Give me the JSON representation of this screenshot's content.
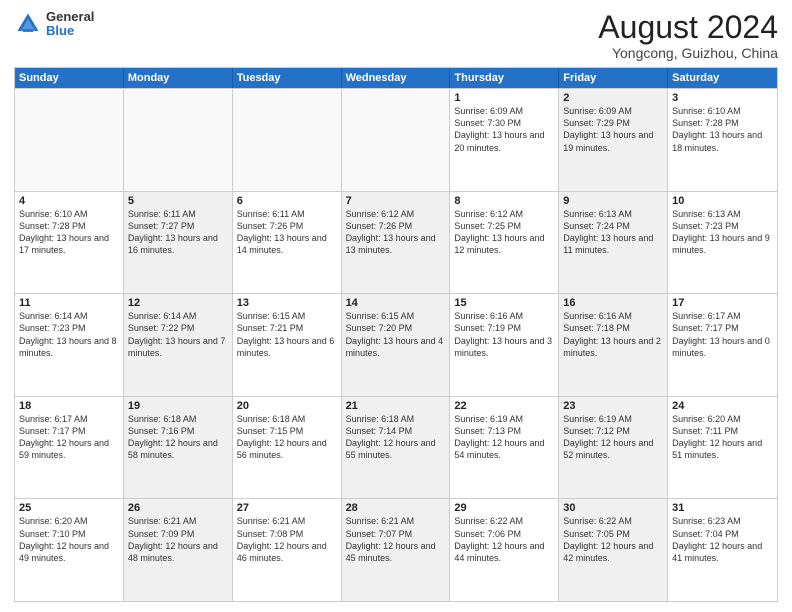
{
  "logo": {
    "general": "General",
    "blue": "Blue"
  },
  "title": "August 2024",
  "location": "Yongcong, Guizhou, China",
  "weekdays": [
    "Sunday",
    "Monday",
    "Tuesday",
    "Wednesday",
    "Thursday",
    "Friday",
    "Saturday"
  ],
  "rows": [
    [
      {
        "day": "",
        "text": "",
        "empty": true
      },
      {
        "day": "",
        "text": "",
        "empty": true
      },
      {
        "day": "",
        "text": "",
        "empty": true
      },
      {
        "day": "",
        "text": "",
        "empty": true
      },
      {
        "day": "1",
        "text": "Sunrise: 6:09 AM\nSunset: 7:30 PM\nDaylight: 13 hours and 20 minutes.",
        "empty": false,
        "shaded": false
      },
      {
        "day": "2",
        "text": "Sunrise: 6:09 AM\nSunset: 7:29 PM\nDaylight: 13 hours and 19 minutes.",
        "empty": false,
        "shaded": true
      },
      {
        "day": "3",
        "text": "Sunrise: 6:10 AM\nSunset: 7:28 PM\nDaylight: 13 hours and 18 minutes.",
        "empty": false,
        "shaded": false
      }
    ],
    [
      {
        "day": "4",
        "text": "Sunrise: 6:10 AM\nSunset: 7:28 PM\nDaylight: 13 hours and 17 minutes.",
        "empty": false,
        "shaded": false
      },
      {
        "day": "5",
        "text": "Sunrise: 6:11 AM\nSunset: 7:27 PM\nDaylight: 13 hours and 16 minutes.",
        "empty": false,
        "shaded": true
      },
      {
        "day": "6",
        "text": "Sunrise: 6:11 AM\nSunset: 7:26 PM\nDaylight: 13 hours and 14 minutes.",
        "empty": false,
        "shaded": false
      },
      {
        "day": "7",
        "text": "Sunrise: 6:12 AM\nSunset: 7:26 PM\nDaylight: 13 hours and 13 minutes.",
        "empty": false,
        "shaded": true
      },
      {
        "day": "8",
        "text": "Sunrise: 6:12 AM\nSunset: 7:25 PM\nDaylight: 13 hours and 12 minutes.",
        "empty": false,
        "shaded": false
      },
      {
        "day": "9",
        "text": "Sunrise: 6:13 AM\nSunset: 7:24 PM\nDaylight: 13 hours and 11 minutes.",
        "empty": false,
        "shaded": true
      },
      {
        "day": "10",
        "text": "Sunrise: 6:13 AM\nSunset: 7:23 PM\nDaylight: 13 hours and 9 minutes.",
        "empty": false,
        "shaded": false
      }
    ],
    [
      {
        "day": "11",
        "text": "Sunrise: 6:14 AM\nSunset: 7:23 PM\nDaylight: 13 hours and 8 minutes.",
        "empty": false,
        "shaded": false
      },
      {
        "day": "12",
        "text": "Sunrise: 6:14 AM\nSunset: 7:22 PM\nDaylight: 13 hours and 7 minutes.",
        "empty": false,
        "shaded": true
      },
      {
        "day": "13",
        "text": "Sunrise: 6:15 AM\nSunset: 7:21 PM\nDaylight: 13 hours and 6 minutes.",
        "empty": false,
        "shaded": false
      },
      {
        "day": "14",
        "text": "Sunrise: 6:15 AM\nSunset: 7:20 PM\nDaylight: 13 hours and 4 minutes.",
        "empty": false,
        "shaded": true
      },
      {
        "day": "15",
        "text": "Sunrise: 6:16 AM\nSunset: 7:19 PM\nDaylight: 13 hours and 3 minutes.",
        "empty": false,
        "shaded": false
      },
      {
        "day": "16",
        "text": "Sunrise: 6:16 AM\nSunset: 7:18 PM\nDaylight: 13 hours and 2 minutes.",
        "empty": false,
        "shaded": true
      },
      {
        "day": "17",
        "text": "Sunrise: 6:17 AM\nSunset: 7:17 PM\nDaylight: 13 hours and 0 minutes.",
        "empty": false,
        "shaded": false
      }
    ],
    [
      {
        "day": "18",
        "text": "Sunrise: 6:17 AM\nSunset: 7:17 PM\nDaylight: 12 hours and 59 minutes.",
        "empty": false,
        "shaded": false
      },
      {
        "day": "19",
        "text": "Sunrise: 6:18 AM\nSunset: 7:16 PM\nDaylight: 12 hours and 58 minutes.",
        "empty": false,
        "shaded": true
      },
      {
        "day": "20",
        "text": "Sunrise: 6:18 AM\nSunset: 7:15 PM\nDaylight: 12 hours and 56 minutes.",
        "empty": false,
        "shaded": false
      },
      {
        "day": "21",
        "text": "Sunrise: 6:18 AM\nSunset: 7:14 PM\nDaylight: 12 hours and 55 minutes.",
        "empty": false,
        "shaded": true
      },
      {
        "day": "22",
        "text": "Sunrise: 6:19 AM\nSunset: 7:13 PM\nDaylight: 12 hours and 54 minutes.",
        "empty": false,
        "shaded": false
      },
      {
        "day": "23",
        "text": "Sunrise: 6:19 AM\nSunset: 7:12 PM\nDaylight: 12 hours and 52 minutes.",
        "empty": false,
        "shaded": true
      },
      {
        "day": "24",
        "text": "Sunrise: 6:20 AM\nSunset: 7:11 PM\nDaylight: 12 hours and 51 minutes.",
        "empty": false,
        "shaded": false
      }
    ],
    [
      {
        "day": "25",
        "text": "Sunrise: 6:20 AM\nSunset: 7:10 PM\nDaylight: 12 hours and 49 minutes.",
        "empty": false,
        "shaded": false
      },
      {
        "day": "26",
        "text": "Sunrise: 6:21 AM\nSunset: 7:09 PM\nDaylight: 12 hours and 48 minutes.",
        "empty": false,
        "shaded": true
      },
      {
        "day": "27",
        "text": "Sunrise: 6:21 AM\nSunset: 7:08 PM\nDaylight: 12 hours and 46 minutes.",
        "empty": false,
        "shaded": false
      },
      {
        "day": "28",
        "text": "Sunrise: 6:21 AM\nSunset: 7:07 PM\nDaylight: 12 hours and 45 minutes.",
        "empty": false,
        "shaded": true
      },
      {
        "day": "29",
        "text": "Sunrise: 6:22 AM\nSunset: 7:06 PM\nDaylight: 12 hours and 44 minutes.",
        "empty": false,
        "shaded": false
      },
      {
        "day": "30",
        "text": "Sunrise: 6:22 AM\nSunset: 7:05 PM\nDaylight: 12 hours and 42 minutes.",
        "empty": false,
        "shaded": true
      },
      {
        "day": "31",
        "text": "Sunrise: 6:23 AM\nSunset: 7:04 PM\nDaylight: 12 hours and 41 minutes.",
        "empty": false,
        "shaded": false
      }
    ]
  ]
}
